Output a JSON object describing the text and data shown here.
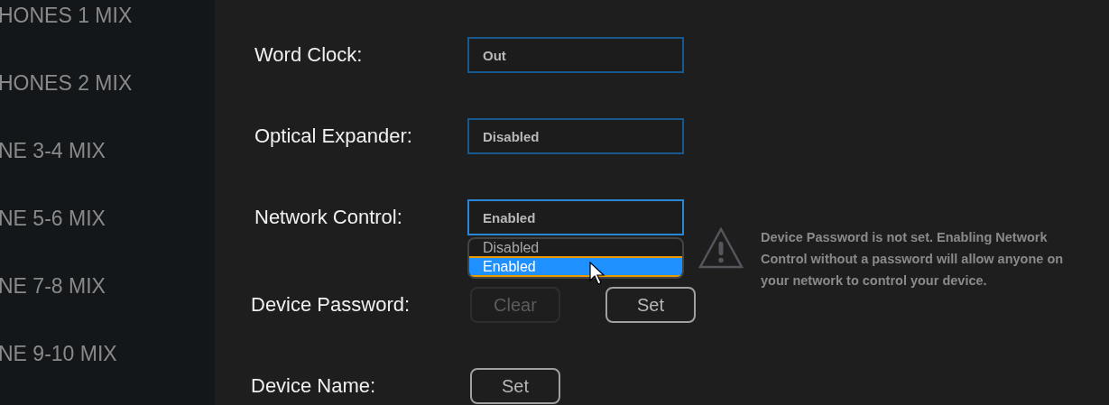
{
  "sidebar": {
    "items": [
      {
        "label": "HONES 1 MIX"
      },
      {
        "label": "HONES 2 MIX"
      },
      {
        "label": "NE 3-4 MIX"
      },
      {
        "label": "NE 5-6 MIX"
      },
      {
        "label": "NE 7-8 MIX"
      },
      {
        "label": "NE 9-10 MIX"
      }
    ]
  },
  "settings": [
    {
      "kind": "select",
      "label": "Word Clock:",
      "value": "Out"
    },
    {
      "kind": "select",
      "label": "Optical Expander:",
      "value": "Disabled"
    },
    {
      "kind": "select",
      "label": "Network Control:",
      "value": "Enabled",
      "expanded": true,
      "options": [
        {
          "label": "Disabled",
          "selected": false
        },
        {
          "label": "Enabled",
          "selected": true
        }
      ],
      "warning": "Device Password is not set. Enabling Network Control without a password will allow anyone on your network to control your device."
    },
    {
      "kind": "buttons",
      "label": "Device Password:",
      "buttons": [
        {
          "label": "Clear",
          "disabled": true
        },
        {
          "label": "Set",
          "disabled": false
        }
      ]
    },
    {
      "kind": "buttons",
      "label": "Device Name:",
      "buttons": [
        {
          "label": "Set",
          "disabled": false
        }
      ]
    }
  ]
}
